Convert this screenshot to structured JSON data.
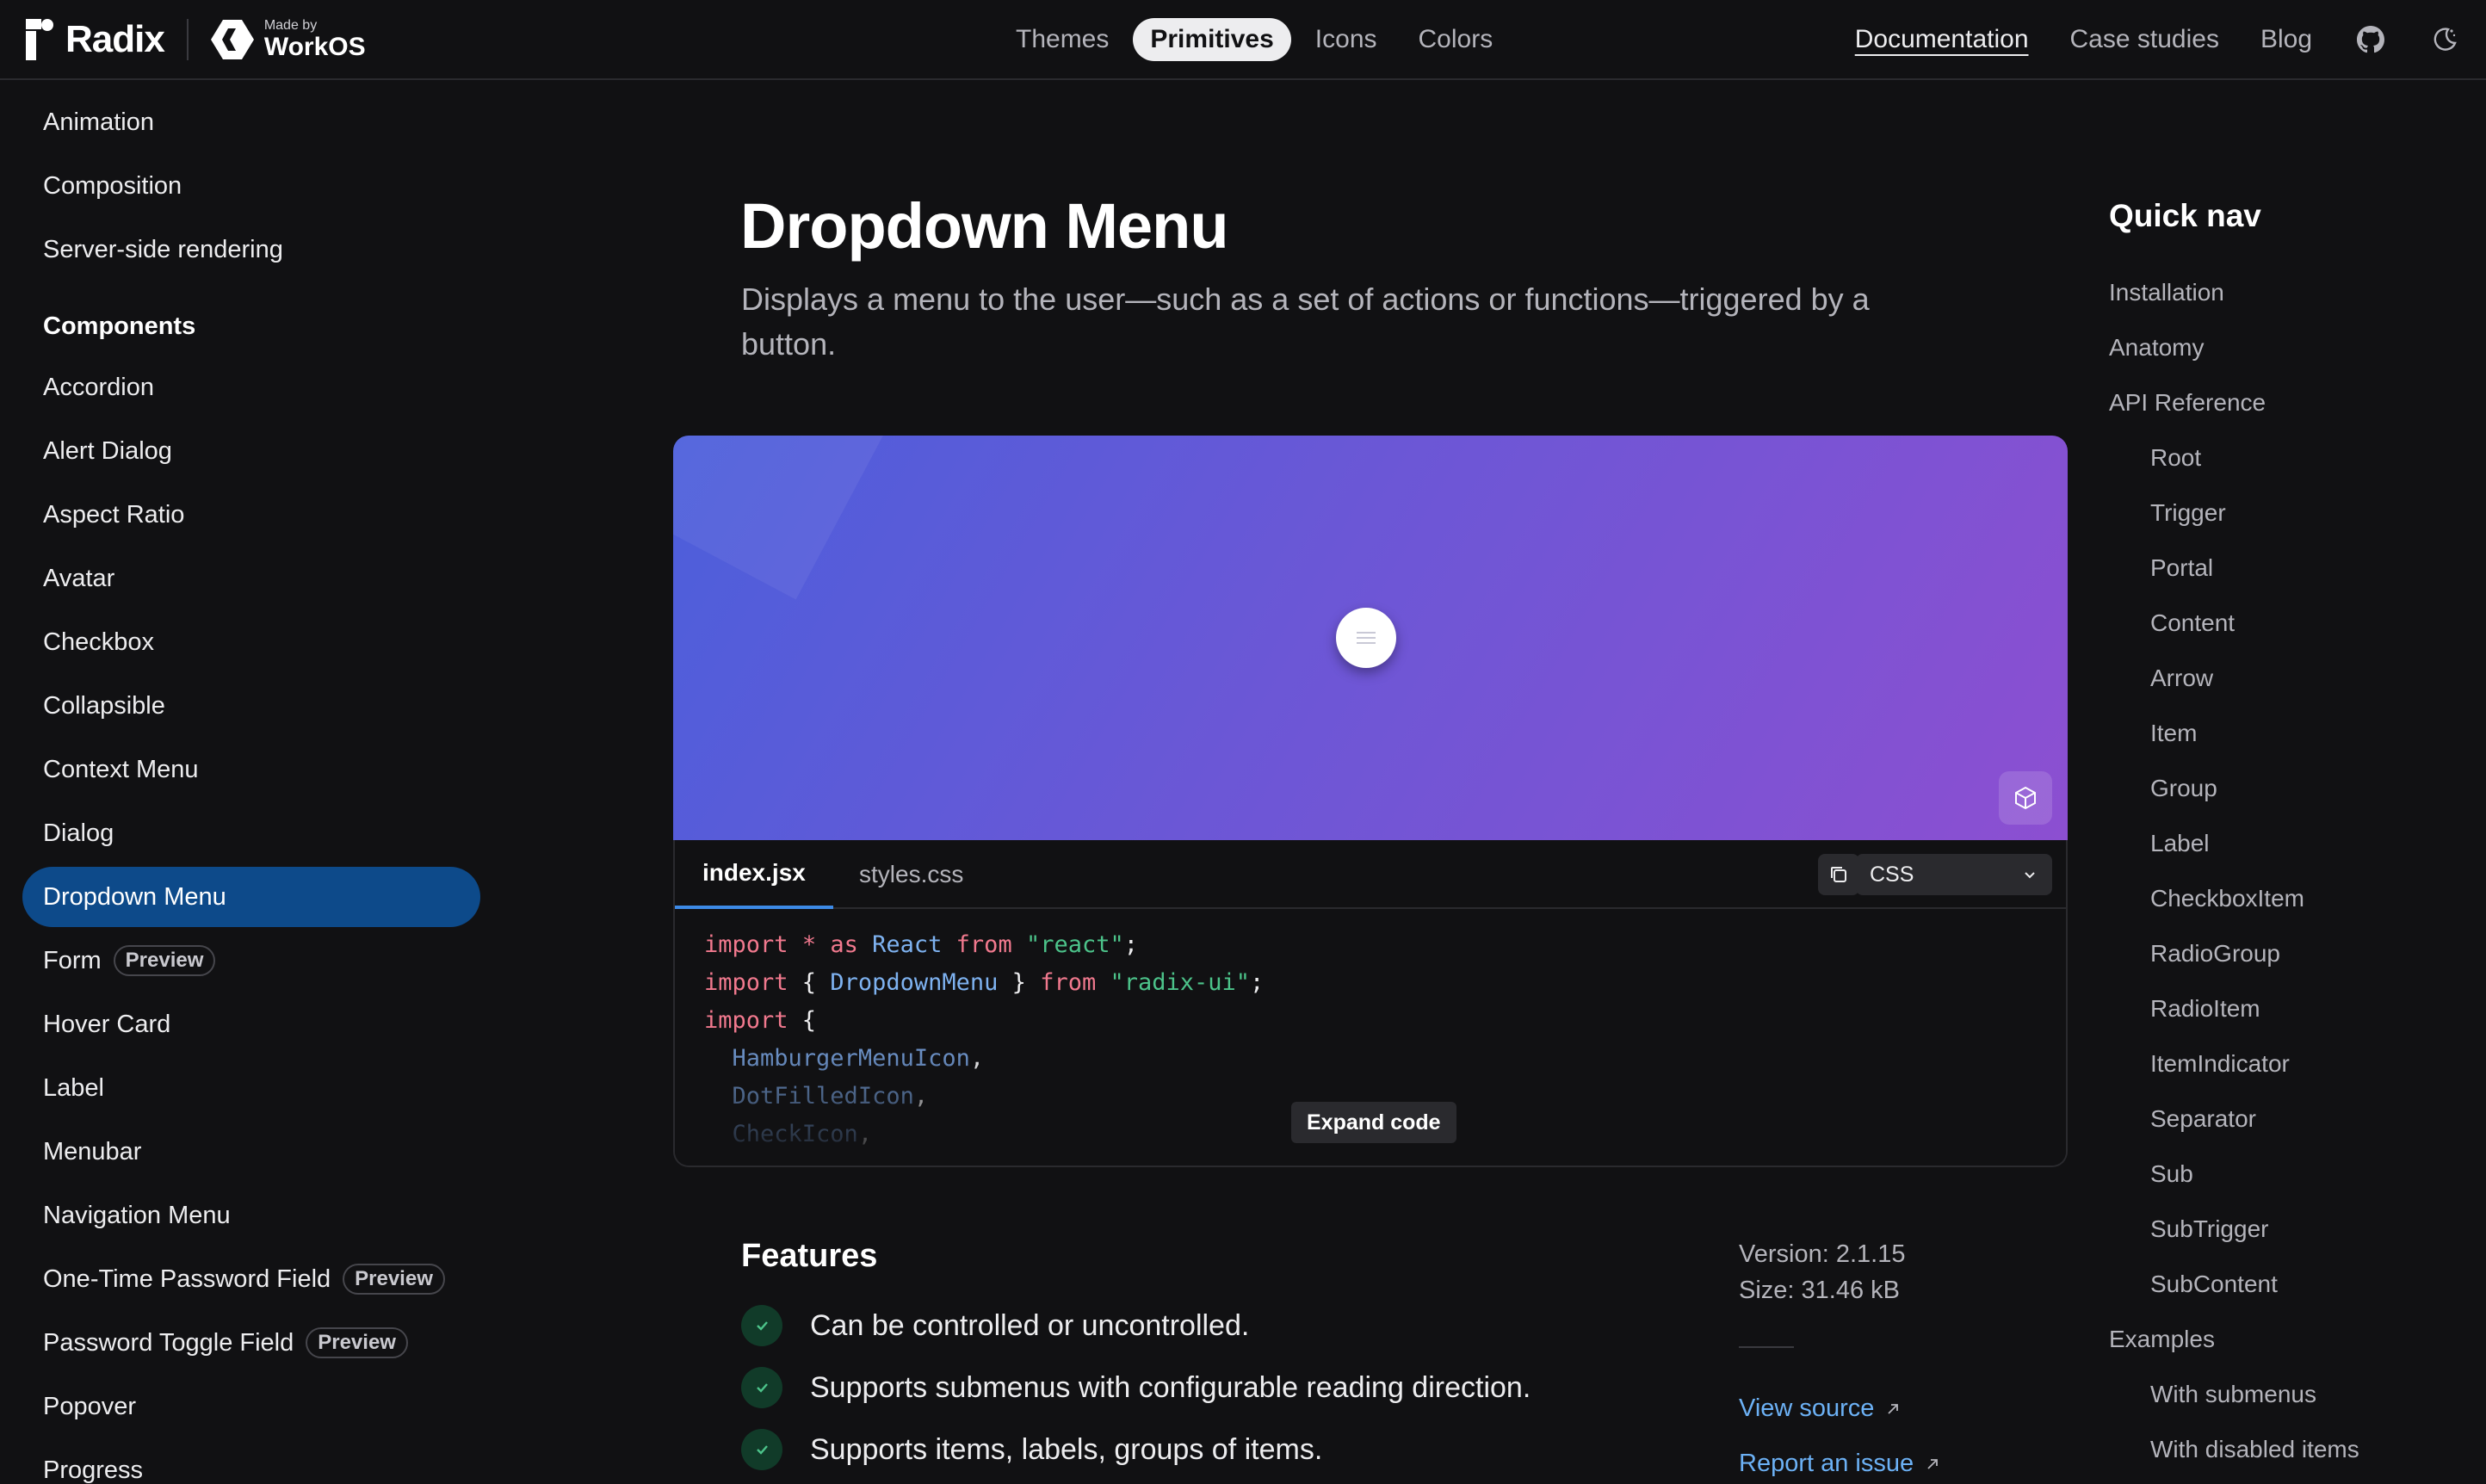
{
  "header": {
    "brand": "Radix",
    "made_by": "Made by",
    "made_by_company": "WorkOS",
    "nav": [
      "Themes",
      "Primitives",
      "Icons",
      "Colors"
    ],
    "active_nav": "Primitives",
    "right_links": [
      "Documentation",
      "Case studies",
      "Blog"
    ]
  },
  "sidebar": {
    "top_items": [
      "Animation",
      "Composition",
      "Server-side rendering"
    ],
    "section_heading": "Components",
    "items": [
      {
        "label": "Accordion"
      },
      {
        "label": "Alert Dialog"
      },
      {
        "label": "Aspect Ratio"
      },
      {
        "label": "Avatar"
      },
      {
        "label": "Checkbox"
      },
      {
        "label": "Collapsible"
      },
      {
        "label": "Context Menu"
      },
      {
        "label": "Dialog"
      },
      {
        "label": "Dropdown Menu",
        "active": true
      },
      {
        "label": "Form",
        "badge": "Preview"
      },
      {
        "label": "Hover Card"
      },
      {
        "label": "Label"
      },
      {
        "label": "Menubar"
      },
      {
        "label": "Navigation Menu"
      },
      {
        "label": "One-Time Password Field",
        "badge": "Preview"
      },
      {
        "label": "Password Toggle Field",
        "badge": "Preview"
      },
      {
        "label": "Popover"
      },
      {
        "label": "Progress"
      }
    ]
  },
  "main": {
    "title": "Dropdown Menu",
    "description": "Displays a menu to the user—such as a set of actions or functions—triggered by a button.",
    "code_tabs": [
      "index.jsx",
      "styles.css"
    ],
    "active_tab": "index.jsx",
    "language_select": "CSS",
    "expand_label": "Expand code",
    "features_title": "Features",
    "features": [
      "Can be controlled or uncontrolled.",
      "Supports submenus with configurable reading direction.",
      "Supports items, labels, groups of items."
    ],
    "version": "Version: 2.1.15",
    "size": "Size: 31.46 kB",
    "view_source": "View source",
    "report_issue": "Report an issue"
  },
  "quicknav": {
    "title": "Quick nav",
    "items": [
      {
        "label": "Installation",
        "level": 0
      },
      {
        "label": "Anatomy",
        "level": 0
      },
      {
        "label": "API Reference",
        "level": 0
      },
      {
        "label": "Root",
        "level": 1
      },
      {
        "label": "Trigger",
        "level": 1
      },
      {
        "label": "Portal",
        "level": 1
      },
      {
        "label": "Content",
        "level": 1
      },
      {
        "label": "Arrow",
        "level": 1
      },
      {
        "label": "Item",
        "level": 1
      },
      {
        "label": "Group",
        "level": 1
      },
      {
        "label": "Label",
        "level": 1
      },
      {
        "label": "CheckboxItem",
        "level": 1
      },
      {
        "label": "RadioGroup",
        "level": 1
      },
      {
        "label": "RadioItem",
        "level": 1
      },
      {
        "label": "ItemIndicator",
        "level": 1
      },
      {
        "label": "Separator",
        "level": 1
      },
      {
        "label": "Sub",
        "level": 1
      },
      {
        "label": "SubTrigger",
        "level": 1
      },
      {
        "label": "SubContent",
        "level": 1
      },
      {
        "label": "Examples",
        "level": 0
      },
      {
        "label": "With submenus",
        "level": 1
      },
      {
        "label": "With disabled items",
        "level": 1
      }
    ]
  },
  "colors": {
    "accent": "#0d4a8a",
    "link": "#6cb1f5",
    "success": "#4cc38a"
  }
}
